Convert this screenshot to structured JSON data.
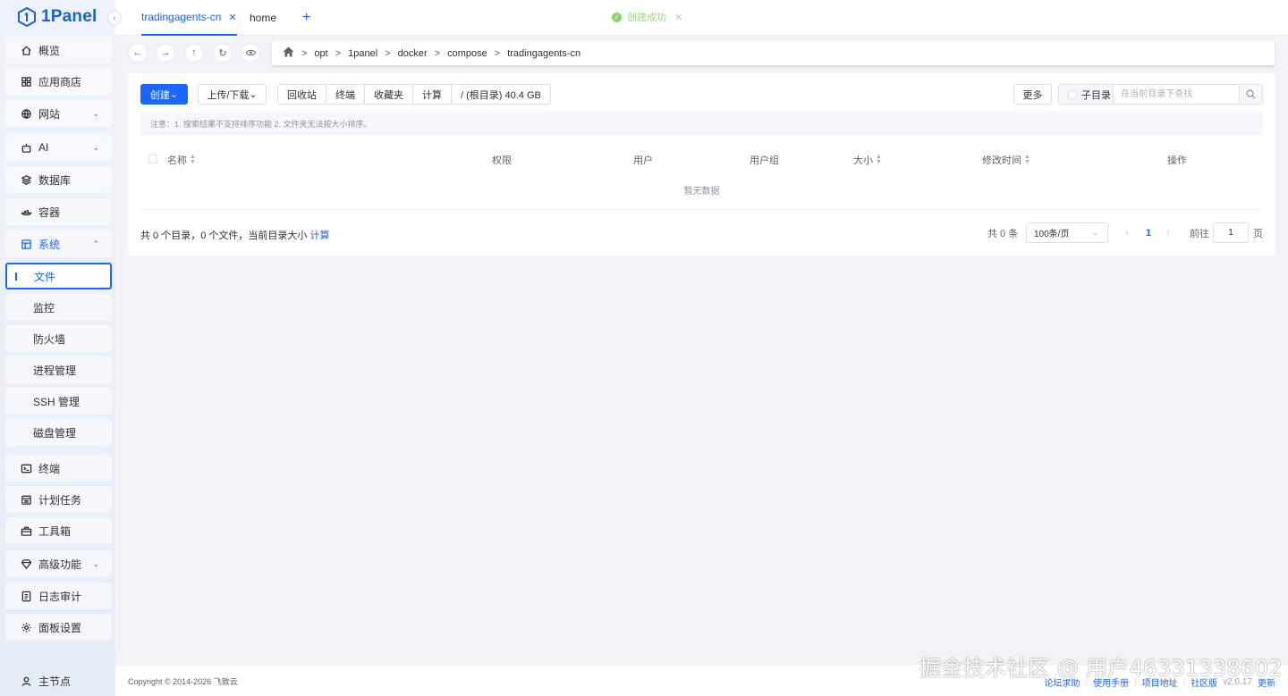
{
  "app": {
    "name": "1Panel"
  },
  "sidebar": {
    "items": [
      {
        "label": "概览",
        "icon": "home-icon"
      },
      {
        "label": "应用商店",
        "icon": "grid-icon"
      },
      {
        "label": "网站",
        "icon": "globe-icon"
      },
      {
        "label": "AI",
        "icon": "robot-icon"
      },
      {
        "label": "数据库",
        "icon": "layers-icon"
      },
      {
        "label": "容器",
        "icon": "container-icon"
      },
      {
        "label": "系统",
        "icon": "system-icon"
      },
      {
        "label": "终端",
        "icon": "terminal-icon"
      },
      {
        "label": "计划任务",
        "icon": "calendar-icon"
      },
      {
        "label": "工具箱",
        "icon": "toolbox-icon"
      },
      {
        "label": "高级功能",
        "icon": "diamond-icon"
      },
      {
        "label": "日志审计",
        "icon": "log-icon"
      },
      {
        "label": "面板设置",
        "icon": "gear-icon"
      },
      {
        "label": "主节点",
        "icon": "user-icon"
      }
    ],
    "system_sub": [
      "文件",
      "监控",
      "防火墙",
      "进程管理",
      "SSH 管理",
      "磁盘管理"
    ]
  },
  "tabs": [
    {
      "label": "tradingagents-cn",
      "active": true
    },
    {
      "label": "home",
      "active": false
    }
  ],
  "toast": {
    "text": "创建成功"
  },
  "path": [
    "opt",
    "1panel",
    "docker",
    "compose",
    "tradingagents-cn"
  ],
  "toolbar": {
    "create": "创建",
    "upload": "上传/下载",
    "group": [
      "回收站",
      "终端",
      "收藏夹",
      "计算",
      "/ (根目录) 40.4 GB"
    ],
    "more": "更多",
    "subdir": "子目录",
    "search_placeholder": "在当前目录下查找"
  },
  "note": "注意：1. 搜索结果不支持排序功能 2. 文件夹无法按大小排序。",
  "table": {
    "columns": [
      "名称",
      "权限",
      "用户",
      "用户组",
      "大小",
      "修改时间",
      "操作"
    ],
    "empty": "暂无数据"
  },
  "summary": {
    "text": "共 0 个目录，0 个文件，当前目录大小",
    "link": "计算"
  },
  "pagination": {
    "total": "共 0 条",
    "page_size": "100条/页",
    "current": "1",
    "goto": "前往",
    "goto_value": "1",
    "page_suffix": "页"
  },
  "footer": {
    "copyright": "Copyright © 2014-2026 飞致云",
    "links": [
      "论坛求助",
      "使用手册",
      "项目地址",
      "社区版"
    ],
    "version": "v2.0.17",
    "update": "更新"
  },
  "watermark": "掘金技术社区 @ 用户46331338602",
  "colors": {
    "accent": "#1a66ff",
    "success": "#8dd46f"
  }
}
